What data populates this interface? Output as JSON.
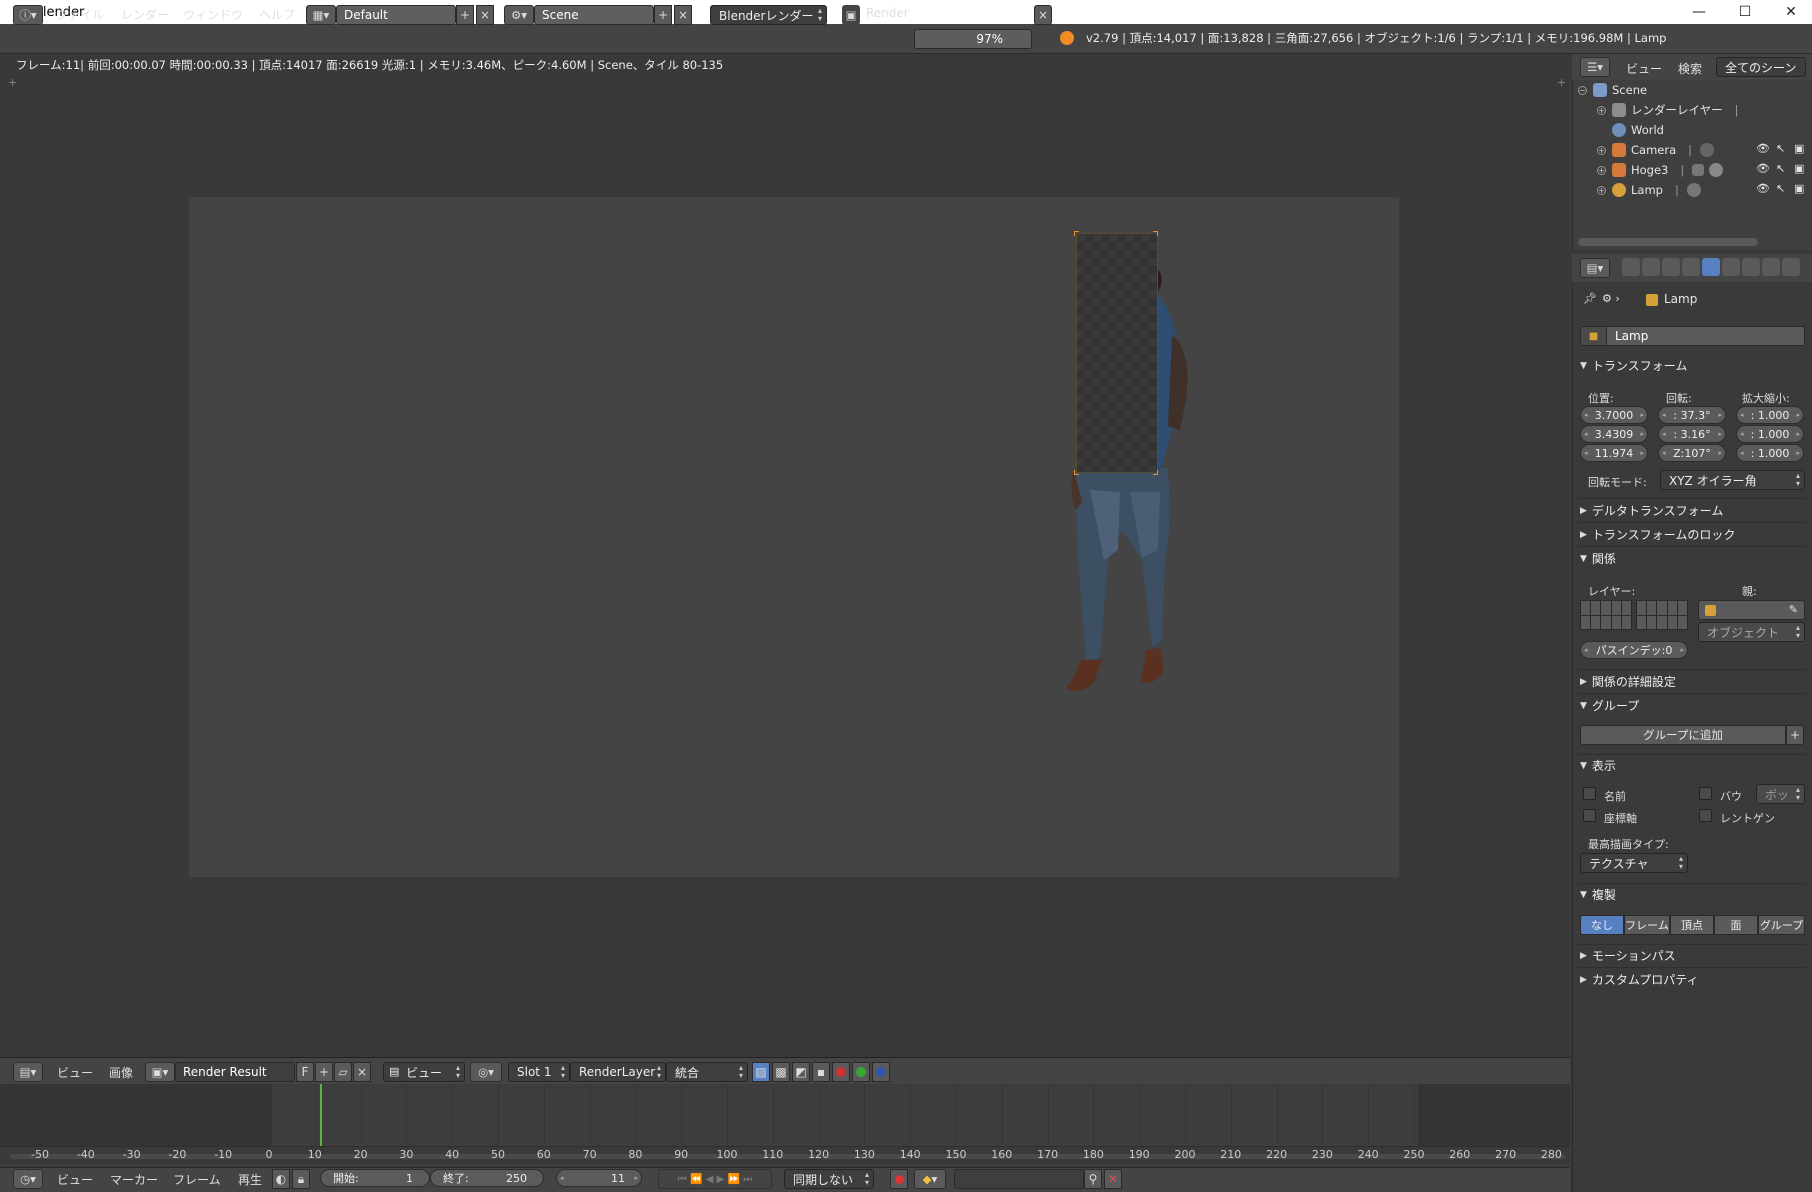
{
  "window": {
    "title": "Blender",
    "controls": [
      "—",
      "☐",
      "✕"
    ]
  },
  "header": {
    "menus": [
      "ファイル",
      "レンダー",
      "ウィンドウ",
      "ヘルプ"
    ],
    "screen_layout": "Default",
    "scene": "Scene",
    "engine": "Blenderレンダー",
    "render_label": "Render",
    "render_percent": "97%",
    "stats": "v2.79 | 頂点:14,017 | 面:13,828 | 三角面:27,656 | オブジェクト:1/6 | ランプ:1/1 | メモリ:196.98M | Lamp"
  },
  "viewport": {
    "status": "フレーム:11| 前回:00:00.07 時間:00:00.33 | 頂点:14017 面:26619 光源:1 | メモリ:3.46M、ピーク:4.60M | Scene、タイル 80-135"
  },
  "image_editor": {
    "menus": [
      "ビュー",
      "画像"
    ],
    "image_name": "Render Result",
    "f_label": "F",
    "view_mode": "ビュー",
    "slot": "Slot 1",
    "layer": "RenderLayer",
    "pass": "統合"
  },
  "timeline": {
    "ticks": [
      "-50",
      "-40",
      "-30",
      "-20",
      "-10",
      "0",
      "10",
      "20",
      "30",
      "40",
      "50",
      "60",
      "70",
      "80",
      "90",
      "100",
      "110",
      "120",
      "130",
      "140",
      "150",
      "160",
      "170",
      "180",
      "190",
      "200",
      "210",
      "220",
      "230",
      "240",
      "250",
      "260",
      "270",
      "280"
    ],
    "menus": [
      "ビュー",
      "マーカー",
      "フレーム",
      "再生"
    ],
    "start_label": "開始:",
    "start": "1",
    "end_label": "終了:",
    "end": "250",
    "current": "11",
    "sync": "同期しない"
  },
  "outliner": {
    "menus": [
      "ビュー",
      "検索"
    ],
    "scene_filter": "全てのシーン",
    "items": [
      {
        "label": "Scene",
        "color": "#7a9cc6"
      },
      {
        "label": "レンダーレイヤー",
        "color": "#8d8d8d"
      },
      {
        "label": "World",
        "color": "#6f8fb8"
      },
      {
        "label": "Camera",
        "color": "#d6793a"
      },
      {
        "label": "Hoge3",
        "color": "#d6793a"
      },
      {
        "label": "Lamp",
        "color": "#d6a03a"
      }
    ]
  },
  "properties": {
    "breadcrumb": "Lamp",
    "object_name": "Lamp",
    "sections": {
      "transform": "トランスフォーム",
      "delta": "デルタトランスフォーム",
      "lock": "トランスフォームのロック",
      "relations": "関係",
      "relations_extra": "関係の詳細設定",
      "groups": "グループ",
      "display": "表示",
      "duplication": "複製",
      "motion_paths": "モーションパス",
      "custom_props": "カスタムプロパティ"
    },
    "location_label": "位置:",
    "rotation_label": "回転:",
    "scale_label": "拡大縮小:",
    "location": [
      "3.7000",
      "3.4309",
      "11.974"
    ],
    "rotation": [
      ": 37.3°",
      ": 3.16°",
      "Z:107°"
    ],
    "scale": [
      ": 1.000",
      ": 1.000",
      ": 1.000"
    ],
    "rotation_mode_label": "回転モード:",
    "rotation_mode": "XYZ オイラー角",
    "layers_label": "レイヤー:",
    "parent_label": "親:",
    "parent_type": "オブジェクト",
    "pass_index": "パスインデッ:0",
    "add_to_group": "グループに追加",
    "display_name": "名前",
    "display_axis": "座標軸",
    "display_bounds": "バウ",
    "bounds_type": "ボッ",
    "display_xray": "レントゲン",
    "max_draw_label": "最高描画タイプ:",
    "max_draw": "テクスチャ",
    "dup_tabs": [
      "なし",
      "フレーム",
      "頂点",
      "面",
      "グループ"
    ]
  }
}
